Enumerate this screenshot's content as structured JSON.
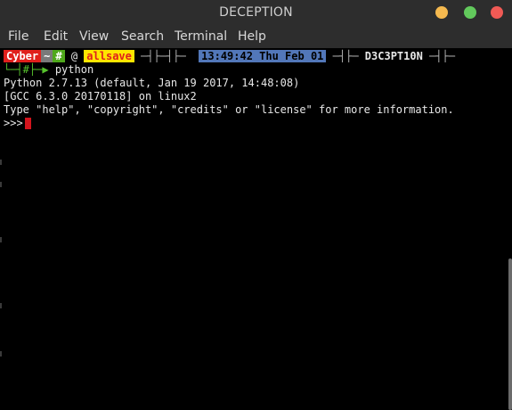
{
  "window": {
    "title": "DECEPTION",
    "colors": {
      "minimize": "#f5b94f",
      "maximize": "#62c95c",
      "close": "#f05a55",
      "chrome": "#2d2d2d"
    }
  },
  "menu": {
    "items": [
      "File",
      "Edit",
      "View",
      "Search",
      "Terminal",
      "Help"
    ]
  },
  "prompt": {
    "user": "Cyber",
    "dir": "~",
    "symbol": "#",
    "at": "@",
    "host": "allsave",
    "sep1": "─┤├─┤├─",
    "time": "13:49:42 Thu Feb 01",
    "sep2": "─┤├─",
    "machine": "D3C3PT10N",
    "sep3": "─┤├─",
    "line2_prefix": "└─┤#├─",
    "arrow": "▶",
    "command": "python"
  },
  "output": {
    "line1": "Python 2.7.13 (default, Jan 19 2017, 14:48:08)",
    "line2": "[GCC 6.3.0 20170118] on linux2",
    "line3": "Type \"help\", \"copyright\", \"credits\" or \"license\" for more information.",
    "repl_prompt": ">>>"
  }
}
